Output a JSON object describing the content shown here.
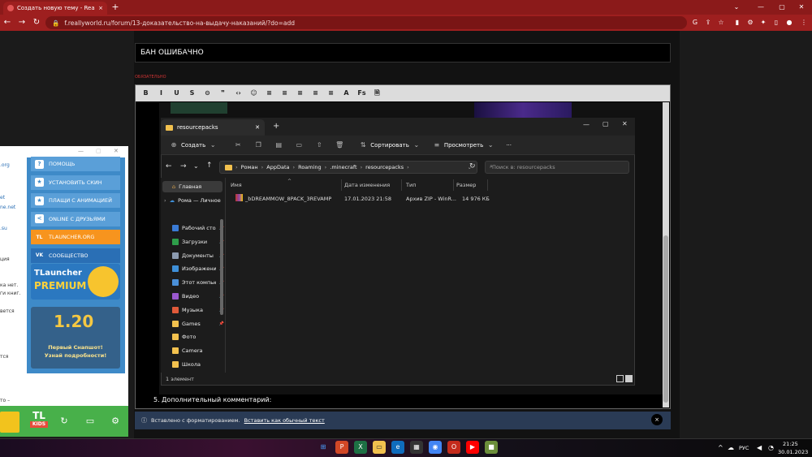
{
  "browser": {
    "tab_title": "Создать новую тему - ReallyWo...",
    "tab_close": "×",
    "new_tab": "+",
    "url": "f.reallyworld.ru/forum/13-доказательство-на-выдачу-наказаний/?do=add"
  },
  "forum": {
    "title_value": "БАН ОШИБАЧНО",
    "required_label": "ОБЯЗАТЕЛЬНО",
    "comment_label": "5. Дополнительный комментарий:",
    "toolbar": [
      "B",
      "I",
      "U",
      "S",
      "⊝",
      "❞",
      "‹›",
      "☺",
      "≡",
      "≡",
      "≡",
      "≡",
      "≡",
      "A",
      "Fs",
      "🗎"
    ]
  },
  "explorer": {
    "tab_title": "resourcepacks",
    "tab_close": "✕",
    "new_tab": "+",
    "commands": {
      "create": "Создать",
      "sort": "Сортировать",
      "view": "Просмотреть",
      "more": "···"
    },
    "breadcrumb": [
      "Роман",
      "AppData",
      "Roaming",
      ".minecraft",
      "resourcepacks"
    ],
    "search_placeholder": "Поиск в: resourcepacks",
    "nav": {
      "home": "Главная",
      "onedrive": "Рома — Личное",
      "items": [
        {
          "label": "Рабочий стол",
          "color": "#3a7bd5"
        },
        {
          "label": "Загрузки",
          "color": "#2e9e4a"
        },
        {
          "label": "Документы",
          "color": "#8c9bb0"
        },
        {
          "label": "Изображения",
          "color": "#3e8fd8"
        },
        {
          "label": "Этот компьютер",
          "color": "#4a90d9"
        },
        {
          "label": "Видео",
          "color": "#9b59d0"
        },
        {
          "label": "Музыка",
          "color": "#e05a3a"
        },
        {
          "label": "Games",
          "color": "#f2c14e"
        },
        {
          "label": "Фото",
          "color": "#f2c14e"
        },
        {
          "label": "Camera",
          "color": "#f2c14e"
        },
        {
          "label": "Школа",
          "color": "#f2c14e"
        }
      ]
    },
    "columns": {
      "name": "Имя",
      "modified": "Дата изменения",
      "type": "Тип",
      "size": "Размер"
    },
    "files": [
      {
        "name": "_bDREAMMOW_8PACK_3REVAMP",
        "modified": "17.01.2023 21:58",
        "type": "Архив ZIP - WinR...",
        "size": "14 976 КБ"
      }
    ],
    "status": "1 элемент"
  },
  "tlauncher": {
    "buttons": [
      {
        "label": "ПОМОЩЬ",
        "icon": "?"
      },
      {
        "label": "УСТАНОВИТЬ СКИН",
        "icon": "★"
      },
      {
        "label": "ПЛАЩИ С АНИМАЦИЕЙ",
        "icon": "★"
      },
      {
        "label": "ONLINE С ДРУЗЬЯМИ",
        "icon": "<"
      },
      {
        "label": "TLAUNCHER.ORG",
        "icon": "TL"
      },
      {
        "label": "СООБЩЕСТВО",
        "icon": "VK"
      }
    ],
    "premium_brand": "TLauncher",
    "premium_word": "PREMIUM",
    "snapshot_version": "1.20",
    "snapshot_line1": "Первый Снапшот!",
    "snapshot_line2": "Узнай подробности!",
    "left_fragments": [
      ".org",
      "et",
      "ne.net",
      ".su",
      "ция",
      "ка нет.",
      "ги книг.",
      "вется",
      "тся",
      "то –"
    ],
    "logo_top": "TL",
    "logo_bottom": "KIDS"
  },
  "paste_notice": {
    "text": "Вставлено с форматированием.",
    "link": "Вставить как обычный текст",
    "close": "×"
  },
  "taskbar": {
    "lang": "РУС",
    "time": "21:25",
    "date": "30.01.2023"
  }
}
